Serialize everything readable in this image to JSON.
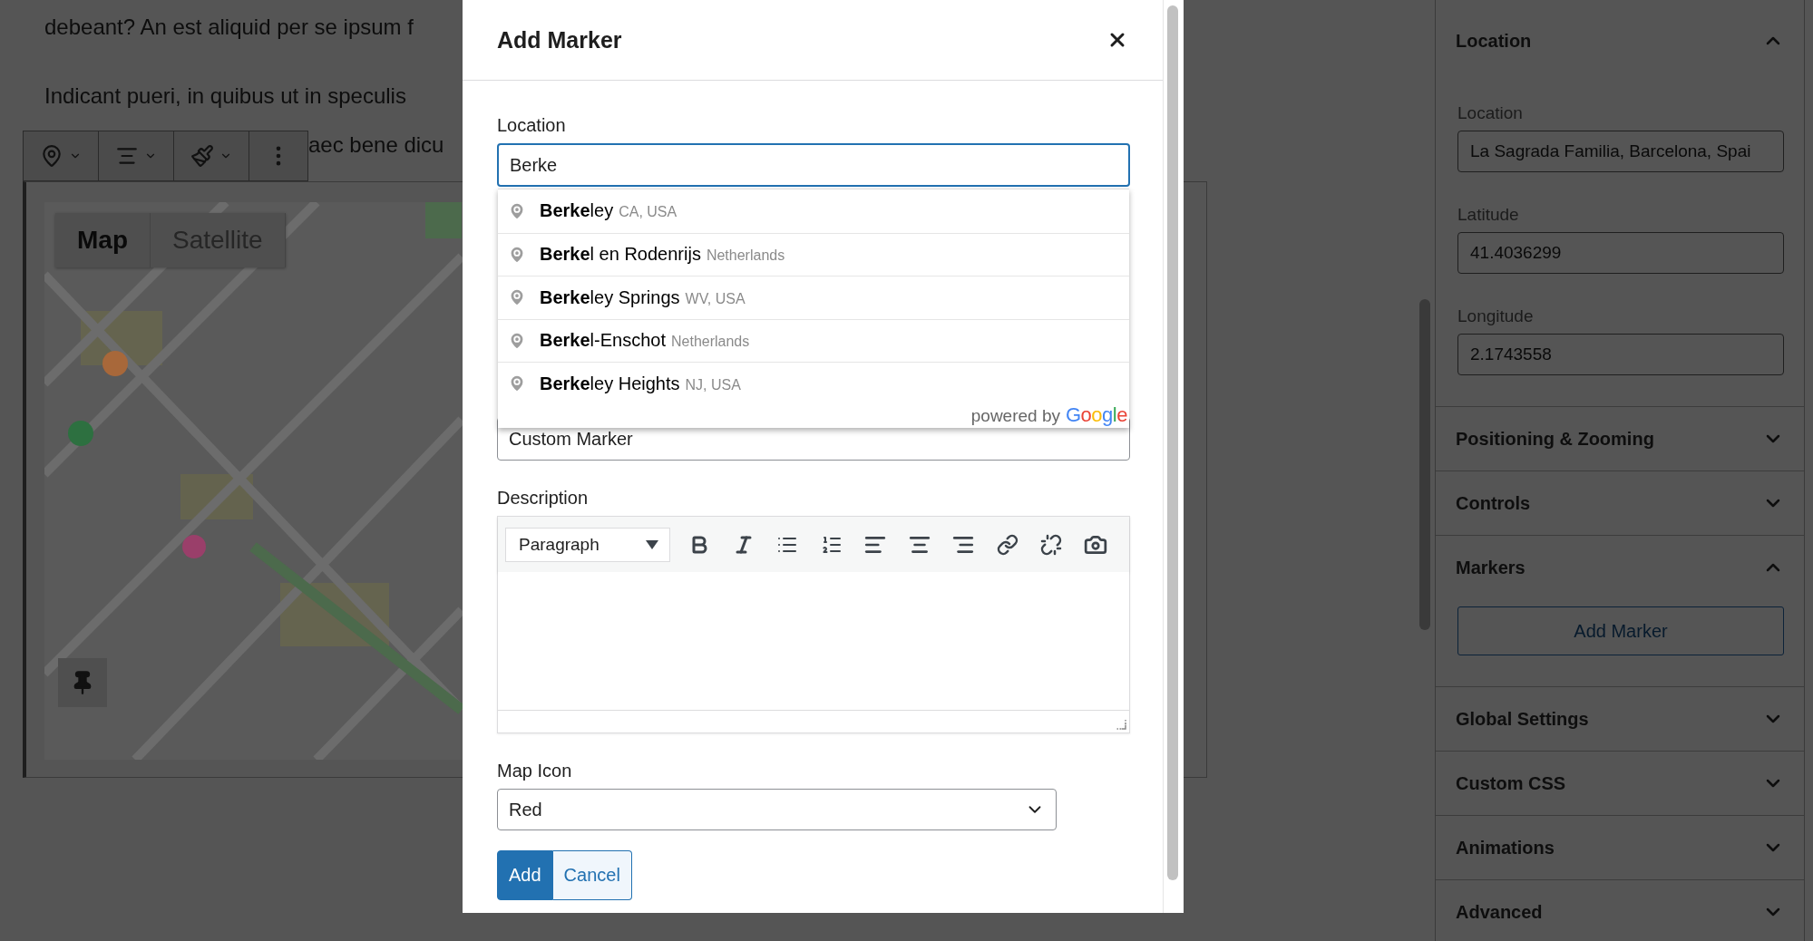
{
  "page": {
    "paragraphs": [
      "debeant? An est aliquid per se ipsum f",
      "Indicant pueri, in quibus ut in speculis"
    ],
    "partial_line": "aec bene dicu"
  },
  "map_block": {
    "map_types": [
      {
        "label": "Map",
        "selected": true
      },
      {
        "label": "Satellite",
        "selected": false
      }
    ]
  },
  "modal": {
    "title": "Add Marker",
    "location": {
      "label": "Location",
      "value": "Berke"
    },
    "suggestions": [
      {
        "name": "**Berke**ley",
        "region": "CA, USA"
      },
      {
        "name": "**Berke**l en Rodenrijs",
        "region": "Netherlands"
      },
      {
        "name": "**Berke**ley Springs",
        "region": "WV, USA"
      },
      {
        "name": "**Berke**l-Enschot",
        "region": "Netherlands"
      },
      {
        "name": "**Berke**ley Heights",
        "region": "NJ, USA"
      }
    ],
    "attribution": {
      "text": "powered by",
      "logo": "Google"
    },
    "title_field": {
      "value": "Custom Marker"
    },
    "description": {
      "label": "Description",
      "format": "Paragraph"
    },
    "map_icon": {
      "label": "Map Icon",
      "value": "Red"
    },
    "buttons": [
      {
        "label": "Add",
        "kind": "primary"
      },
      {
        "label": "Cancel",
        "kind": "secondary"
      }
    ]
  },
  "sidebar": {
    "sections": [
      {
        "title": "Location",
        "expanded": true,
        "fields": [
          {
            "label": "Location",
            "value": "La Sagrada Familia, Barcelona, Spai"
          },
          {
            "label": "Latitude",
            "value": "41.4036299"
          },
          {
            "label": "Longitude",
            "value": "2.1743558"
          }
        ]
      },
      {
        "title": "Positioning & Zooming",
        "expanded": false
      },
      {
        "title": "Controls",
        "expanded": false
      },
      {
        "title": "Markers",
        "expanded": true,
        "button": "Add Marker"
      },
      {
        "title": "Global Settings",
        "expanded": false
      },
      {
        "title": "Custom CSS",
        "expanded": false
      },
      {
        "title": "Animations",
        "expanded": false
      },
      {
        "title": "Advanced",
        "expanded": false
      }
    ]
  }
}
